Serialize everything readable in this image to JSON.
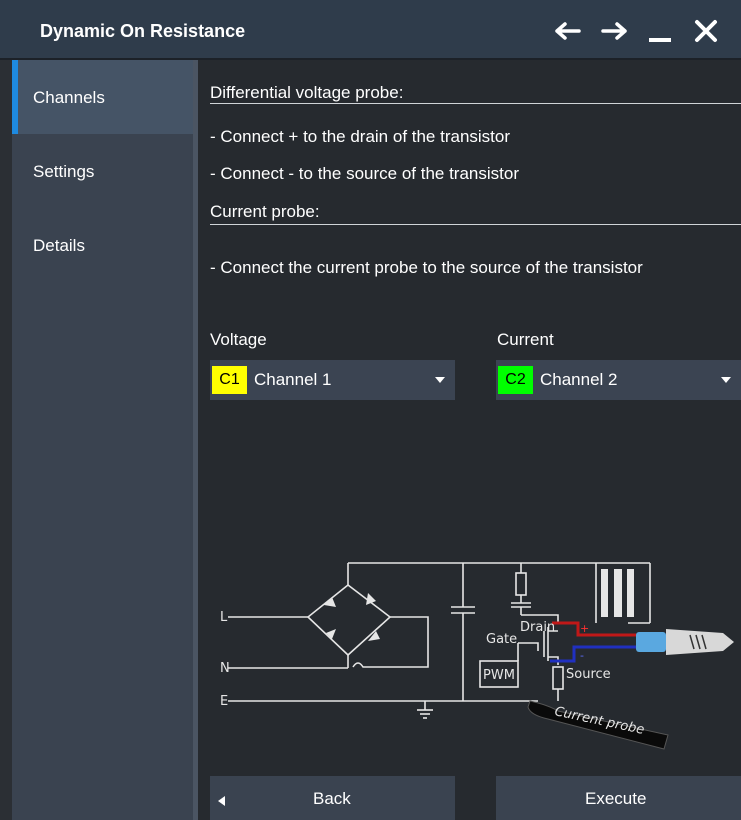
{
  "window": {
    "title": "Dynamic On Resistance",
    "controls": {
      "back_icon": "arrow-left-icon",
      "forward_icon": "arrow-right-icon",
      "minimize_icon": "minimize-icon",
      "close_icon": "close-icon"
    }
  },
  "sidebar": {
    "items": [
      {
        "label": "Channels",
        "active": true
      },
      {
        "label": "Settings",
        "active": false
      },
      {
        "label": "Details",
        "active": false
      }
    ],
    "accent_color": "#1e8ae0"
  },
  "main": {
    "voltage_header": "Differential voltage probe:",
    "voltage_line1": "- Connect + to the drain of the transistor",
    "voltage_line2": "- Connect - to the source of the transistor",
    "current_header": "Current probe:",
    "current_line1": "- Connect the current probe to the source of the transistor",
    "voltage_label": "Voltage",
    "current_label": "Current",
    "voltage_select": {
      "badge": "C1",
      "value": "Channel 1",
      "badge_color": "#ffff00"
    },
    "current_select": {
      "badge": "C2",
      "value": "Channel 2",
      "badge_color": "#00ff00"
    }
  },
  "diagram": {
    "label_L": "L",
    "label_N": "N",
    "label_E": "E",
    "label_drain": "Drain",
    "label_gate": "Gate",
    "label_pwm": "PWM",
    "label_source": "Source",
    "label_current_probe": "Current probe"
  },
  "footer": {
    "back_label": "Back",
    "execute_label": "Execute",
    "back_icon": "triangle-left-icon"
  }
}
